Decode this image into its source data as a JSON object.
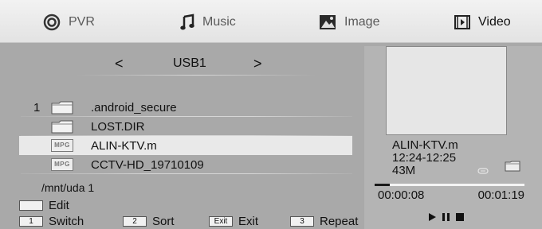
{
  "tabs": [
    {
      "label": "PVR",
      "icon": "pvr-icon",
      "active": false
    },
    {
      "label": "Music",
      "icon": "music-note-icon",
      "active": false
    },
    {
      "label": "Image",
      "icon": "image-icon",
      "active": false
    },
    {
      "label": "Video",
      "icon": "video-icon",
      "active": true
    }
  ],
  "nav": {
    "prev": "<",
    "title": "USB1",
    "next": ">"
  },
  "files": [
    {
      "num": "1",
      "type": "folder",
      "name": ".android_secure"
    },
    {
      "num": "",
      "type": "folder",
      "name": "LOST.DIR"
    },
    {
      "num": "",
      "type": "mpg",
      "badge": "MPG",
      "name": "ALIN-KTV.m",
      "selected": true
    },
    {
      "num": "",
      "type": "mpg",
      "badge": "MPG",
      "name": "CCTV-HD_19710109"
    }
  ],
  "path": "/mnt/uda 1",
  "legend": {
    "edit": {
      "key": "",
      "label": "Edit"
    },
    "switch": {
      "key": "1",
      "label": "Switch"
    },
    "sort": {
      "key": "2",
      "label": "Sort"
    },
    "exit": {
      "key": "Exit",
      "label": "Exit"
    },
    "repeat": {
      "key": "3",
      "label": "Repeat"
    }
  },
  "info": {
    "filename": "ALIN-KTV.m",
    "date_line1": "12:24-12:25",
    "size": "43M"
  },
  "playback": {
    "current": "00:00:08",
    "total": "00:01:19",
    "progress_fraction": 0.1
  },
  "colors": {
    "background": "#a9a9a9",
    "selected_row": "#e9e9e9",
    "tabbar": "#eeeeee"
  }
}
